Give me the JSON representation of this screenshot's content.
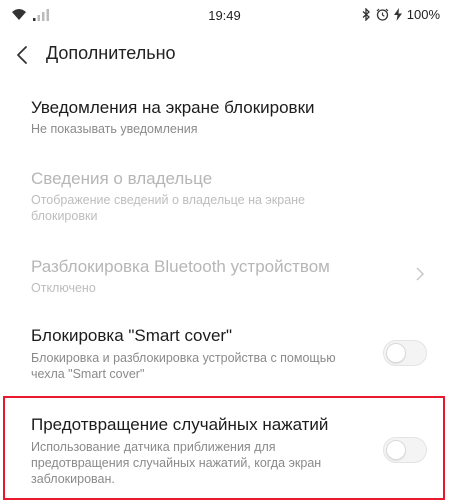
{
  "status_bar": {
    "time": "19:49",
    "battery": "100%",
    "icons": [
      "wifi-icon",
      "signal-icon",
      "bluetooth-icon",
      "alarm-icon",
      "charging-icon"
    ]
  },
  "header": {
    "title": "Дополнительно",
    "back_icon": "chevron-left-icon"
  },
  "items": [
    {
      "title": "Уведомления на экране блокировки",
      "subtitle": "Не показывать уведомления",
      "enabled": true
    },
    {
      "title": "Сведения о владельце",
      "subtitle": "Отображение сведений о владельце на экране блокировки",
      "enabled": false
    },
    {
      "title": "Разблокировка Bluetooth устройством",
      "subtitle": "Отключено",
      "enabled": false,
      "accessory": "chevron-right-icon"
    },
    {
      "title": "Блокировка \"Smart cover\"",
      "subtitle": "Блокировка и разблокировка устройства с помощью чехла \"Smart cover\"",
      "enabled": true,
      "toggle_on": false
    },
    {
      "title": "Предотвращение случайных нажатий",
      "subtitle": "Использование датчика приближения для предотвращения случайных нажатий, когда экран заблокирован.",
      "enabled": true,
      "toggle_on": false
    }
  ],
  "colors": {
    "highlight": "#e8192c",
    "text_primary": "#1c1c1c",
    "text_secondary": "#8a8a8a",
    "text_disabled": "#b6b6b6"
  }
}
